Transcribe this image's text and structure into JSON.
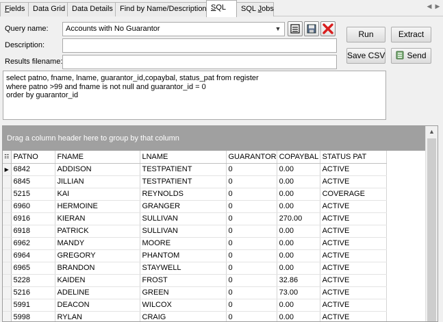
{
  "tabs": [
    {
      "label": "Fields",
      "mnemonic": "F",
      "rest": "ields"
    },
    {
      "label": "Data Grid"
    },
    {
      "label": "Data Details"
    },
    {
      "label": "Find by Name/Description"
    },
    {
      "label": "SQL",
      "mnemonic": "S",
      "rest": "QL"
    },
    {
      "label": "SQL Jobs",
      "pre": "SQL ",
      "mnemonic": "J",
      "rest": "obs"
    }
  ],
  "active_tab": "SQL",
  "form": {
    "query_name_label": "Query name:",
    "query_name_value": "Accounts with No Guarantor",
    "description_label": "Description:",
    "description_value": "",
    "results_filename_label": "Results filename:",
    "results_filename_value": ""
  },
  "buttons": {
    "run": "Run",
    "extract": "Extract",
    "save_csv": "Save CSV",
    "send": "Send"
  },
  "sql_lines": [
    "select patno, fname, lname, guarantor_id,copaybal, status_pat from register",
    "where patno >99 and fname is not null and guarantor_id = 0",
    "order by guarantor_id"
  ],
  "grid": {
    "group_hint": "Drag a column header here to group by that column",
    "columns": [
      "PATNO",
      "FNAME",
      "LNAME",
      "GUARANTOR",
      "COPAYBAL",
      "STATUS PAT"
    ],
    "rows": [
      [
        "6842",
        "ADDISON",
        "TESTPATIENT",
        "0",
        "0.00",
        "ACTIVE"
      ],
      [
        "6845",
        "JILLIAN",
        "TESTPATIENT",
        "0",
        "0.00",
        "ACTIVE"
      ],
      [
        "5215",
        "KAI",
        "REYNOLDS",
        "0",
        "0.00",
        "COVERAGE"
      ],
      [
        "6960",
        "HERMOINE",
        "GRANGER",
        "0",
        "0.00",
        "ACTIVE"
      ],
      [
        "6916",
        "KIERAN",
        "SULLIVAN",
        "0",
        "270.00",
        "ACTIVE"
      ],
      [
        "6918",
        "PATRICK",
        "SULLIVAN",
        "0",
        "0.00",
        "ACTIVE"
      ],
      [
        "6962",
        "MANDY",
        "MOORE",
        "0",
        "0.00",
        "ACTIVE"
      ],
      [
        "6964",
        "GREGORY",
        "PHANTOM",
        "0",
        "0.00",
        "ACTIVE"
      ],
      [
        "6965",
        "BRANDON",
        "STAYWELL",
        "0",
        "0.00",
        "ACTIVE"
      ],
      [
        "5228",
        "KAIDEN",
        "FROST",
        "0",
        "32.86",
        "ACTIVE"
      ],
      [
        "5216",
        "ADELINE",
        "GREEN",
        "0",
        "73.00",
        "ACTIVE"
      ],
      [
        "5991",
        "DEACON",
        "WILCOX",
        "0",
        "0.00",
        "ACTIVE"
      ],
      [
        "5998",
        "RYLAN",
        "CRAIG",
        "0",
        "0.00",
        "ACTIVE"
      ]
    ]
  },
  "icons": {
    "open": "open-query-icon",
    "save": "save-query-icon",
    "delete": "delete-query-icon",
    "send": "send-mail-icon",
    "scroll_up": "chevron-up-icon",
    "row_indicator": "current-row-arrow-icon",
    "column_chooser": "column-chooser-icon"
  },
  "colors": {
    "groupby_bg": "#a0a0a0",
    "delete_red": "#d81e1e"
  }
}
